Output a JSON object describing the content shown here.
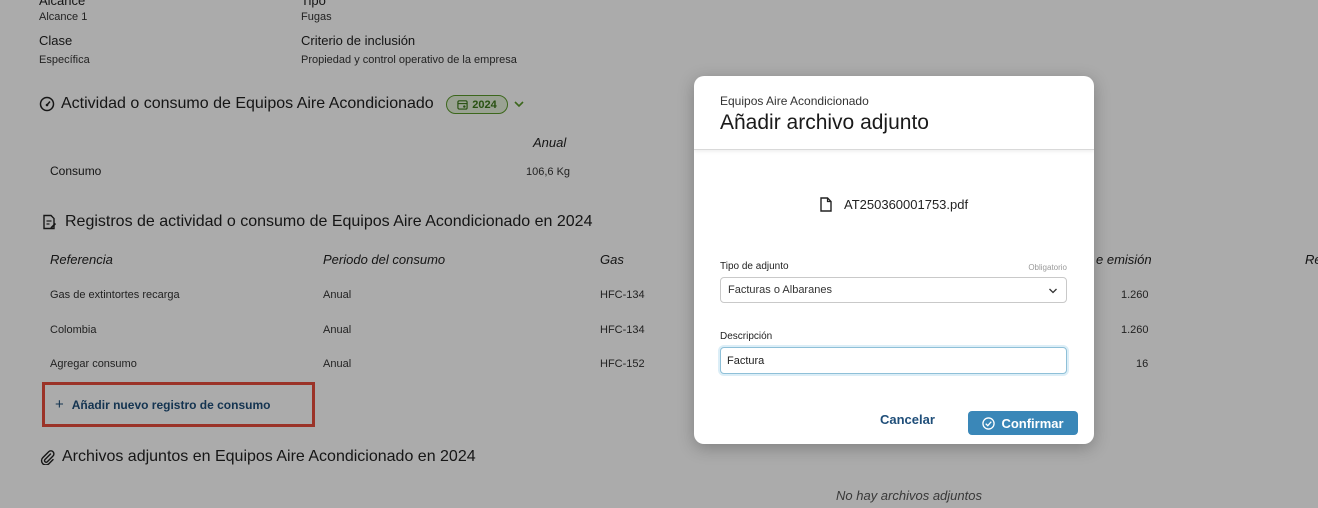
{
  "info": {
    "alcance_label": "Alcance",
    "alcance_value": "Alcance 1",
    "tipo_label": "Tipo",
    "tipo_value": "Fugas",
    "clase_label": "Clase",
    "clase_value": "Específica",
    "criterio_label": "Criterio de inclusión",
    "criterio_value": "Propiedad y control operativo de la empresa"
  },
  "activity": {
    "title": "Actividad o consumo de Equipos Aire Acondicionado",
    "year": "2024",
    "column": "Anual",
    "row_label": "Consumo",
    "row_value": "106,6 Kg"
  },
  "records": {
    "title": "Registros de actividad o consumo de Equipos Aire Acondicionado en 2024",
    "headers": [
      "Referencia",
      "Periodo del consumo",
      "Gas",
      "e emisión",
      "Re"
    ],
    "rows": [
      {
        "ref": "Gas de extintortes recarga",
        "periodo": "Anual",
        "gas": "HFC-134",
        "emision": "1.260"
      },
      {
        "ref": "Colombia",
        "periodo": "Anual",
        "gas": "HFC-134",
        "emision": "1.260"
      },
      {
        "ref": "Agregar consumo",
        "periodo": "Anual",
        "gas": "HFC-152",
        "emision": "16"
      }
    ],
    "add_label": "Añadir nuevo registro de consumo"
  },
  "attachments": {
    "title": "Archivos adjuntos en Equipos Aire Acondicionado en 2024",
    "empty_text": "No hay archivos adjuntos"
  },
  "modal": {
    "subtitle": "Equipos Aire Acondicionado",
    "title": "Añadir archivo adjunto",
    "file_name": "AT250360001753.pdf",
    "tipo_label": "Tipo de adjunto",
    "required_text": "Obligatorio",
    "tipo_value": "Facturas o Albaranes",
    "desc_label": "Descripción",
    "desc_value": "Factura",
    "cancel_label": "Cancelar",
    "confirm_label": "Confirmar"
  },
  "colors": {
    "accent_blue": "#3a87b8",
    "link_blue": "#1f4e79",
    "badge_green": "#5a9a2a",
    "highlight_red": "#e74c3c"
  }
}
